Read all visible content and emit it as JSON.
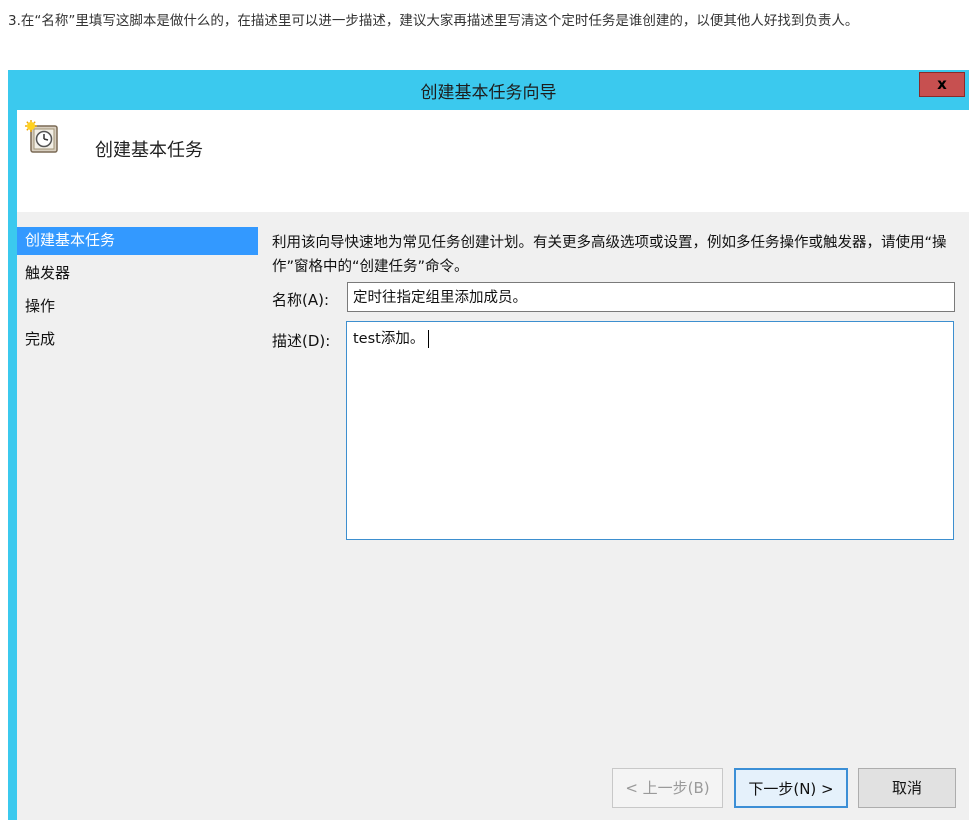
{
  "intro_text": "3.在“名称”里填写这脚本是做什么的，在描述里可以进一步描述，建议大家再描述里写清这个定时任务是谁创建的，以便其他人好找到负责人。",
  "dialog": {
    "title": "创建基本任务向导",
    "close_label": "x",
    "header_title": "创建基本任务",
    "steps": [
      "创建基本任务",
      "触发器",
      "操作",
      "完成"
    ],
    "description": "利用该向导快速地为常见任务创建计划。有关更多高级选项或设置，例如多任务操作或触发器，请使用“操作”窗格中的“创建任务”命令。",
    "name_label": "名称(A):",
    "name_value": "定时往指定组里添加成员。",
    "desc_label": "描述(D):",
    "desc_value": "test添加。",
    "back_label": "< 上一步(B)",
    "next_label": "下一步(N) >",
    "cancel_label": "取消"
  },
  "colors": {
    "title_bar": "#3bc9ee",
    "close_button": "#c75050",
    "selected_step": "#3399ff"
  }
}
